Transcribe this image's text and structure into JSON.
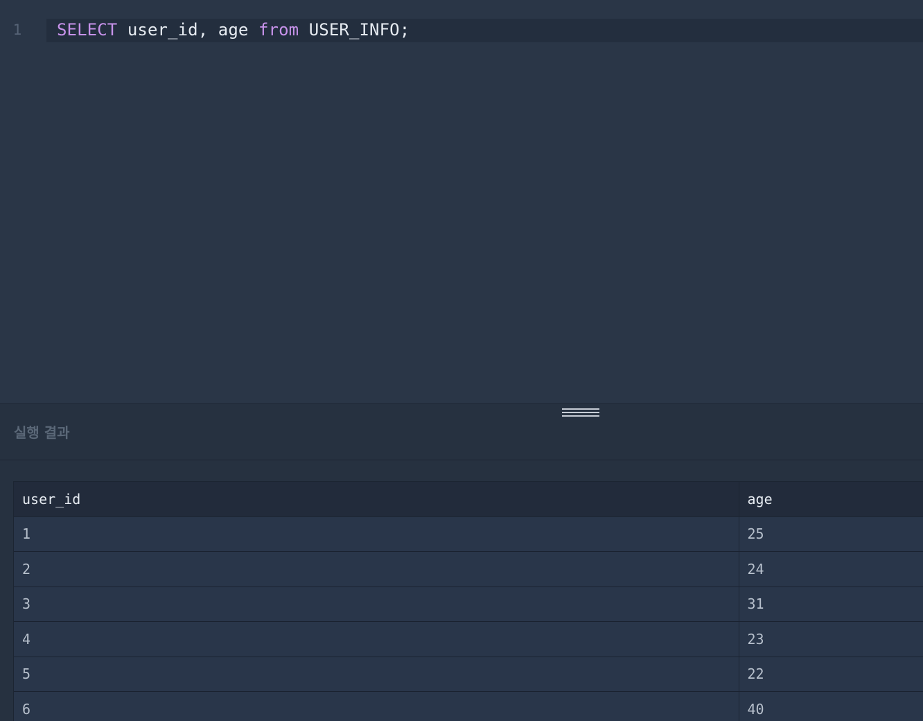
{
  "editor": {
    "line_number": "1",
    "tokens": {
      "kw_select": "SELECT",
      "cols": " user_id, age ",
      "kw_from": "from",
      "rest": " USER_INFO;"
    }
  },
  "result": {
    "title": "실행 결과",
    "columns": [
      "user_id",
      "age"
    ],
    "rows": [
      [
        "1",
        "25"
      ],
      [
        "2",
        "24"
      ],
      [
        "3",
        "31"
      ],
      [
        "4",
        "23"
      ],
      [
        "5",
        "22"
      ],
      [
        "6",
        "40"
      ]
    ]
  },
  "colors": {
    "keyword": "#c792ea",
    "editor_bg": "#2a3647",
    "current_line_bg": "#232e3e"
  }
}
